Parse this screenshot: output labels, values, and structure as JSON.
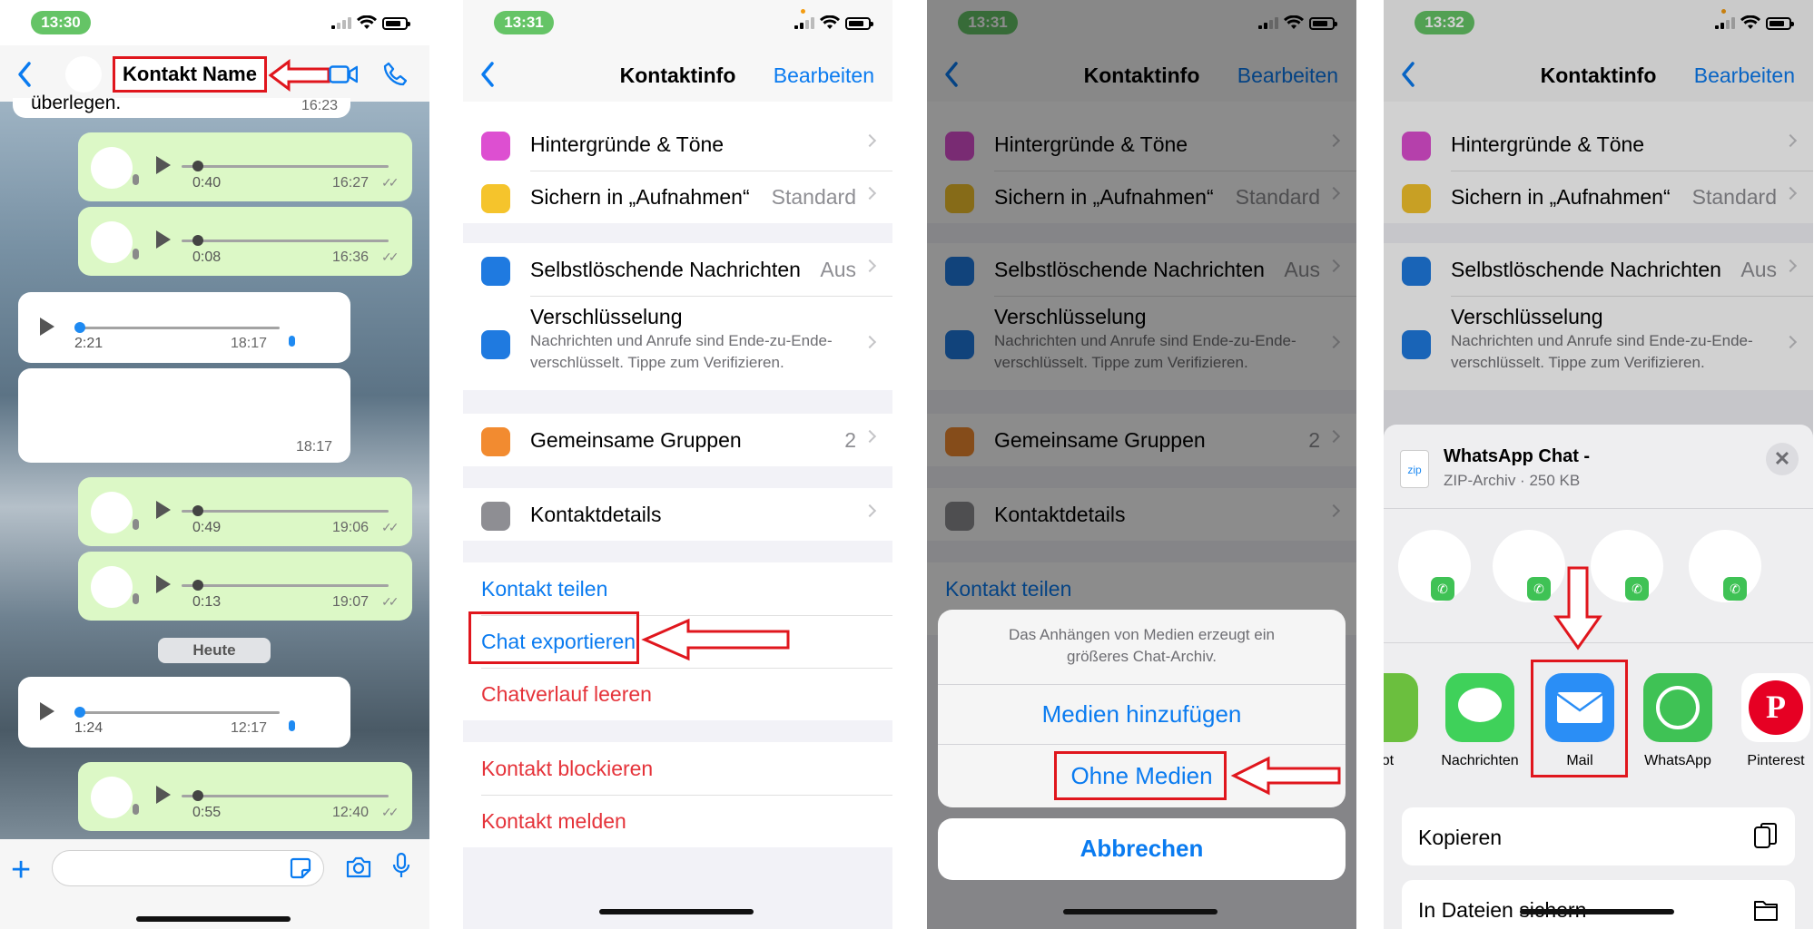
{
  "panel1": {
    "time": "13:30",
    "contact_name": "Kontakt Name",
    "partial_text": "überlegen.",
    "partial_time": "16:23",
    "voice_out": [
      {
        "duration": "0:40",
        "time": "16:27"
      },
      {
        "duration": "0:08",
        "time": "16:36"
      },
      {
        "duration": "0:49",
        "time": "19:06"
      },
      {
        "duration": "0:13",
        "time": "19:07"
      },
      {
        "duration": "0:55",
        "time": "12:40"
      }
    ],
    "voice_in": [
      {
        "duration": "2:21",
        "time": "18:17"
      },
      {
        "duration": "1:24",
        "time": "12:17"
      }
    ],
    "text_in_time": "18:17",
    "date_separator": "Heute",
    "icons": [
      "back-chevron-icon",
      "video-icon",
      "phone-icon",
      "plus-icon",
      "sticker-icon",
      "camera-icon",
      "microphone-icon"
    ]
  },
  "panel2": {
    "time": "13:31",
    "nav": {
      "title": "Kontaktinfo",
      "edit": "Bearbeiten"
    },
    "rows": {
      "wallpaper": "Hintergründe & Töne",
      "save": "Sichern in „Aufnahmen“",
      "save_value": "Standard",
      "disappearing": "Selbstlöschende Nachrichten",
      "disappearing_value": "Aus",
      "encryption": "Verschlüsselung",
      "encryption_sub": "Nachrichten und Anrufe sind Ende-zu-Ende-verschlüsselt. Tippe zum Verifizieren.",
      "groups": "Gemeinsame Gruppen",
      "groups_count": "2",
      "details": "Kontaktdetails"
    },
    "actions": {
      "share": "Kontakt teilen",
      "export": "Chat exportieren",
      "clear": "Chatverlauf leeren",
      "block": "Kontakt blockieren",
      "report": "Kontakt melden"
    }
  },
  "panel3": {
    "time": "13:31",
    "sheet_message": "Das Anhängen von Medien erzeugt ein größeres Chat-Archiv.",
    "with_media": "Medien hinzufügen",
    "without_media": "Ohne Medien",
    "cancel": "Abbrechen"
  },
  "panel4": {
    "time": "13:32",
    "file_title": "WhatsApp Chat -",
    "file_sub": "ZIP-Archiv · 250 KB",
    "zip_label": "zip",
    "close": "✕",
    "apps": [
      {
        "label": "oot",
        "color": "#6bbf3e"
      },
      {
        "label": "Nachrichten",
        "color": "#3fd15a"
      },
      {
        "label": "Mail",
        "color": "#2a8ef6"
      },
      {
        "label": "WhatsApp",
        "color": "#3fc255"
      },
      {
        "label": "Pinterest",
        "color": "#e60023"
      }
    ],
    "options": {
      "copy": "Kopieren",
      "save_files": "In Dateien sichern"
    }
  },
  "colors": {
    "accent": "#0a7bf0",
    "destructive": "#e5333a",
    "highlight": "#e0161d",
    "bubble_out": "#dcf8c6",
    "status_green": "#65c466"
  }
}
